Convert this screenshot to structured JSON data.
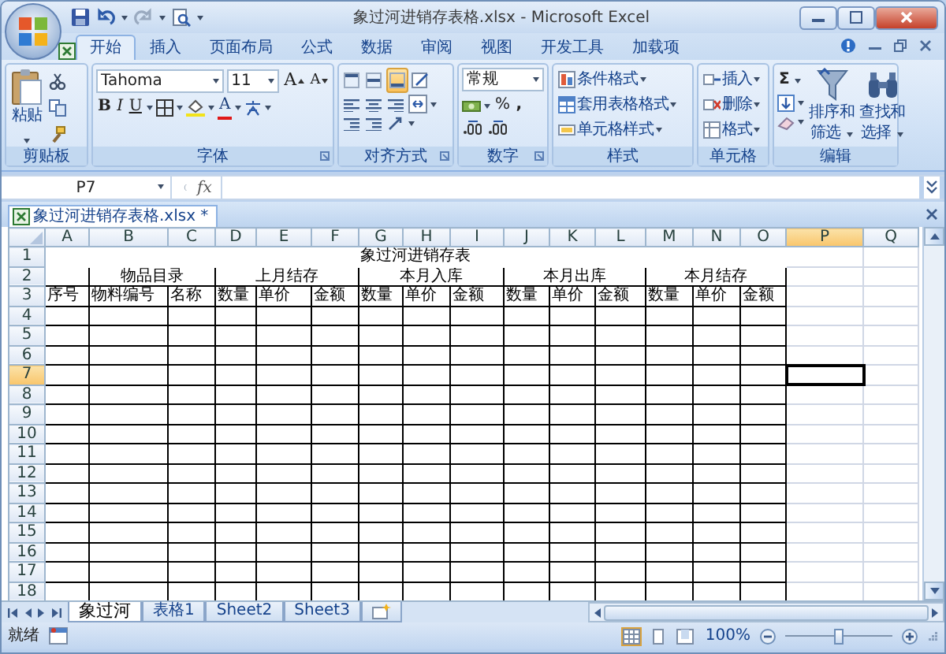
{
  "window": {
    "title": "象过河进销存表格.xlsx - Microsoft Excel"
  },
  "ribbon_tabs": [
    {
      "label": "开始",
      "selected": true
    },
    {
      "label": "插入",
      "selected": false
    },
    {
      "label": "页面布局",
      "selected": false
    },
    {
      "label": "公式",
      "selected": false
    },
    {
      "label": "数据",
      "selected": false
    },
    {
      "label": "审阅",
      "selected": false
    },
    {
      "label": "视图",
      "selected": false
    },
    {
      "label": "开发工具",
      "selected": false
    },
    {
      "label": "加载项",
      "selected": false
    }
  ],
  "ribbon_groups": [
    {
      "kind": "clipboard",
      "title": "剪贴板",
      "paste_label": "粘贴"
    },
    {
      "kind": "font",
      "title": "字体",
      "font_name": "Tahoma",
      "font_size": "11",
      "grow_glyph": "A",
      "shrink_glyph": "A",
      "bold_glyph": "B",
      "italic_glyph": "I",
      "underline_glyph": "U",
      "color_glyph": "A"
    },
    {
      "kind": "alignment",
      "title": "对齐方式",
      "vertical_align": [
        {
          "selected": false
        },
        {
          "selected": false
        },
        {
          "selected": true
        }
      ]
    },
    {
      "kind": "number",
      "title": "数字",
      "format": "常规",
      "percent_glyph": "%",
      "comma_glyph": ","
    },
    {
      "kind": "styles",
      "title": "样式",
      "items": [
        "条件格式",
        "套用表格格式",
        "单元格样式"
      ]
    },
    {
      "kind": "cells",
      "title": "单元格",
      "items": [
        "插入",
        "删除",
        "格式"
      ]
    },
    {
      "kind": "editing",
      "title": "编辑",
      "sum_glyph": "Σ",
      "sort_label": [
        "排序和",
        "筛选"
      ],
      "find_label": [
        "查找和",
        "选择"
      ]
    }
  ],
  "formula_bar": {
    "name_box": "P7",
    "fx": "fx"
  },
  "workbook_tab": {
    "title": "象过河进销存表格.xlsx *"
  },
  "sheet": {
    "columns": [
      {
        "label": "A",
        "selected": false
      },
      {
        "label": "B",
        "selected": false
      },
      {
        "label": "C",
        "selected": false
      },
      {
        "label": "D",
        "selected": false
      },
      {
        "label": "E",
        "selected": false
      },
      {
        "label": "F",
        "selected": false
      },
      {
        "label": "G",
        "selected": false
      },
      {
        "label": "H",
        "selected": false
      },
      {
        "label": "I",
        "selected": false
      },
      {
        "label": "J",
        "selected": false
      },
      {
        "label": "K",
        "selected": false
      },
      {
        "label": "L",
        "selected": false
      },
      {
        "label": "M",
        "selected": false
      },
      {
        "label": "N",
        "selected": false
      },
      {
        "label": "O",
        "selected": false
      },
      {
        "label": "P",
        "selected": true
      },
      {
        "label": "Q",
        "selected": false
      }
    ],
    "rows": [
      {
        "label": "1",
        "selected": false
      },
      {
        "label": "2",
        "selected": false
      },
      {
        "label": "3",
        "selected": false
      },
      {
        "label": "4",
        "selected": false
      },
      {
        "label": "5",
        "selected": false
      },
      {
        "label": "6",
        "selected": false
      },
      {
        "label": "7",
        "selected": true
      },
      {
        "label": "8",
        "selected": false
      },
      {
        "label": "9",
        "selected": false
      },
      {
        "label": "10",
        "selected": false
      },
      {
        "label": "11",
        "selected": false
      },
      {
        "label": "12",
        "selected": false
      },
      {
        "label": "13",
        "selected": false
      },
      {
        "label": "14",
        "selected": false
      },
      {
        "label": "15",
        "selected": false
      },
      {
        "label": "16",
        "selected": false
      },
      {
        "label": "17",
        "selected": false
      },
      {
        "label": "18",
        "selected": false
      }
    ],
    "title": "象过河进销存表",
    "column_groups": [
      {
        "fields": [
          "序号"
        ]
      },
      {
        "label": "物品目录",
        "fields": [
          "物料编号",
          "名称"
        ]
      },
      {
        "label": "上月结存",
        "fields": [
          "数量",
          "单价",
          "金额"
        ]
      },
      {
        "label": "本月入库",
        "fields": [
          "数量",
          "单价",
          "金额"
        ]
      },
      {
        "label": "本月出库",
        "fields": [
          "数量",
          "单价",
          "金额"
        ]
      },
      {
        "label": "本月结存",
        "fields": [
          "数量",
          "单价",
          "金额"
        ]
      }
    ]
  },
  "sheet_tabs": [
    {
      "label": "象过河",
      "selected": true
    },
    {
      "label": "表格1",
      "selected": false
    },
    {
      "label": "Sheet2",
      "selected": false
    },
    {
      "label": "Sheet3",
      "selected": false
    }
  ],
  "status_bar": {
    "text": "就绪",
    "view_buttons": [
      {
        "selected": true
      },
      {
        "selected": false
      },
      {
        "selected": false
      }
    ],
    "zoom": "100%",
    "zoom_slider": {
      "level": 0.5
    }
  }
}
